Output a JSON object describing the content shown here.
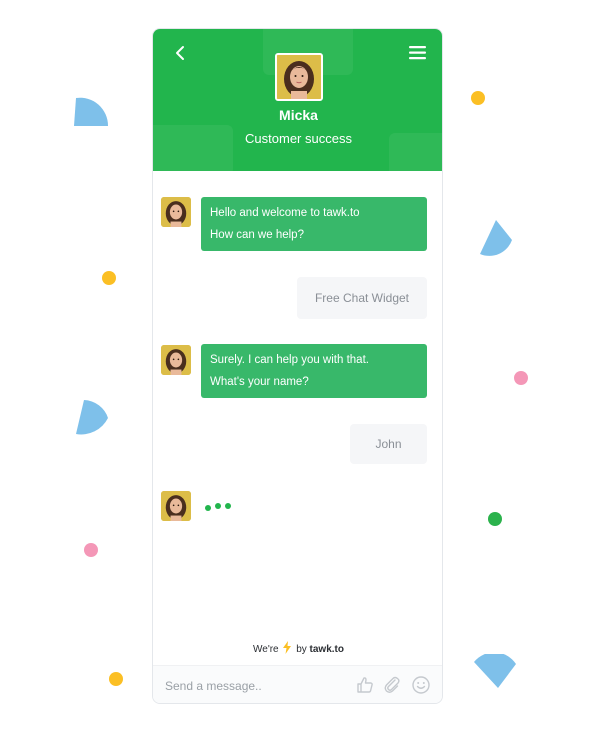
{
  "colors": {
    "header_bg": "#22b54d",
    "agent_bubble": "#38b86a",
    "user_bubble": "#f5f6f8",
    "confetti_blue": "#7ec0ea",
    "confetti_yellow": "#fbbf24",
    "confetti_pink": "#f497b7",
    "confetti_green": "#2bb24c"
  },
  "header": {
    "back_icon": "chevron-left-icon",
    "menu_icon": "hamburger-menu-icon",
    "agent_name": "Micka",
    "agent_role": "Customer success"
  },
  "messages": [
    {
      "from": "agent",
      "lines": [
        "Hello and welcome to tawk.to",
        "How can we help?"
      ]
    },
    {
      "from": "user",
      "text": "Free Chat Widget"
    },
    {
      "from": "agent",
      "lines": [
        "Surely. I can help you with that.",
        "What's your name?"
      ]
    },
    {
      "from": "user",
      "text": "John"
    },
    {
      "from": "agent",
      "typing": true
    }
  ],
  "footer": {
    "prefix": "We're",
    "suffix": "by",
    "brand": "tawk.to",
    "bolt_icon": "lightning-bolt-icon"
  },
  "composer": {
    "placeholder": "Send a message..",
    "value": "",
    "icons": [
      "thumbs-up-icon",
      "paperclip-icon",
      "emoji-icon"
    ]
  }
}
